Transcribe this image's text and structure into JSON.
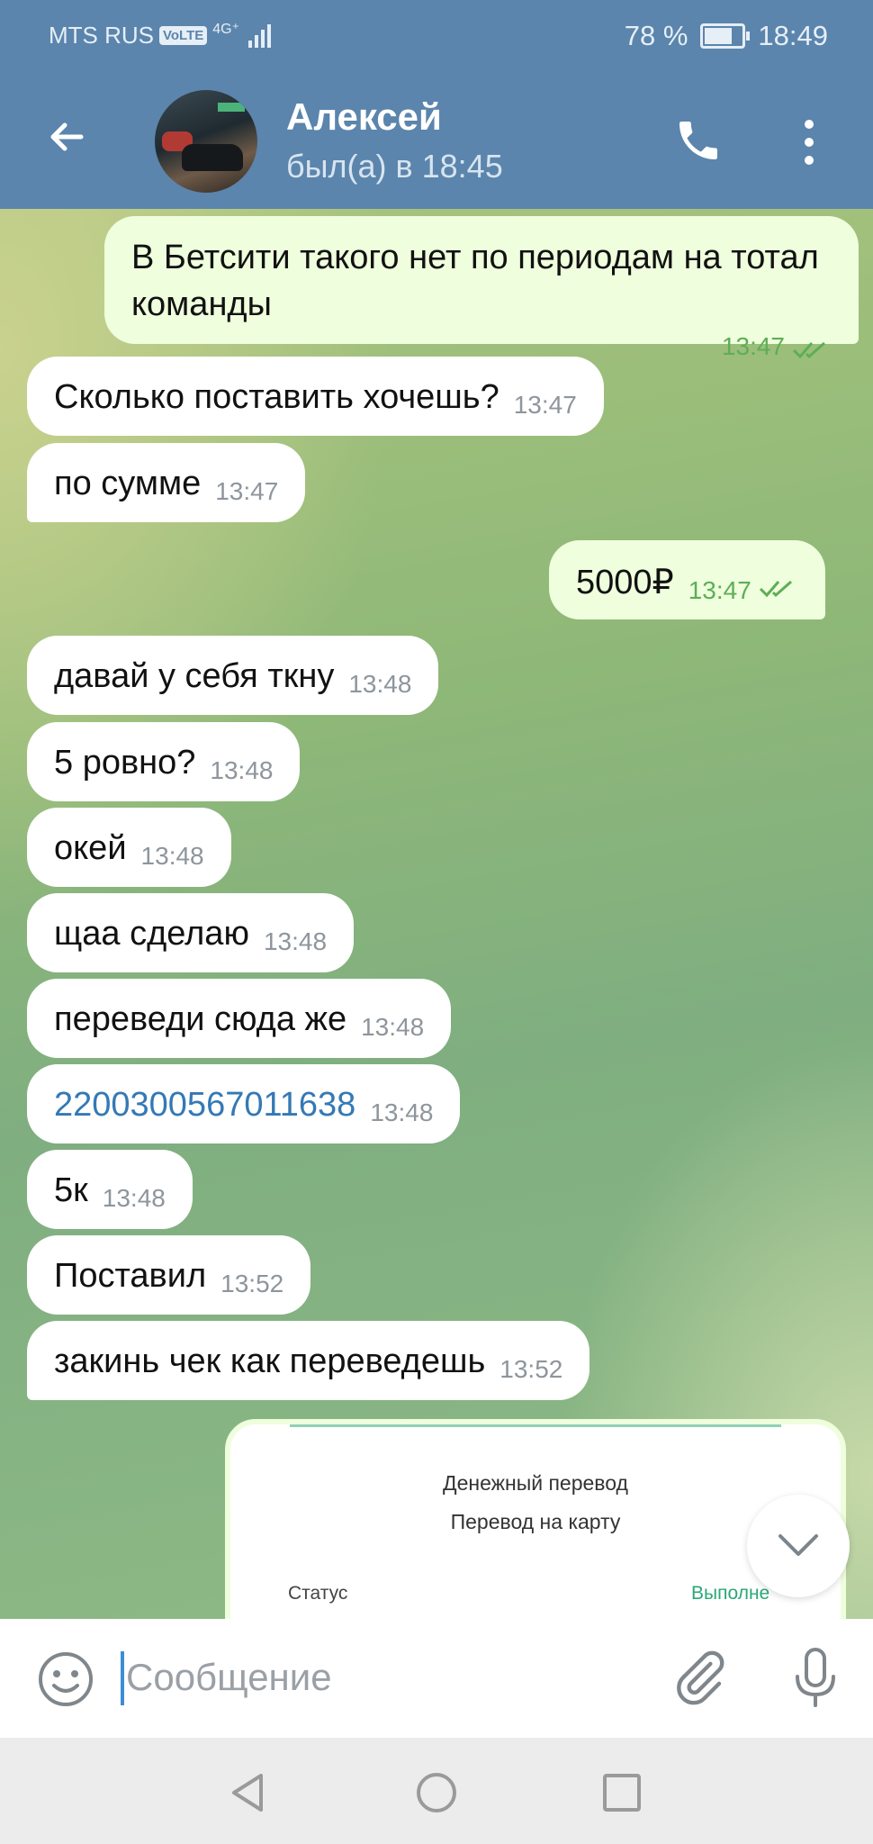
{
  "status_bar": {
    "carrier": "MTS RUS",
    "volte": "VoLTE",
    "network": "4G⁺",
    "battery": "78 %",
    "battery_level": 0.78,
    "time": "18:49"
  },
  "header": {
    "contact_name": "Алексей",
    "last_seen": "был(а) в 18:45"
  },
  "messages": [
    {
      "text": "В Бетсити такого нет по периодам на тотал команды",
      "time": "13:47",
      "outgoing": true
    },
    {
      "text": "Сколько поставить хочешь?",
      "time": "13:47",
      "outgoing": false
    },
    {
      "text": "по сумме",
      "time": "13:47",
      "outgoing": false
    },
    {
      "text": "5000₽",
      "time": "13:47",
      "outgoing": true
    },
    {
      "text": "давай у себя ткну",
      "time": "13:48",
      "outgoing": false
    },
    {
      "text": "5 ровно?",
      "time": "13:48",
      "outgoing": false
    },
    {
      "text": "окей",
      "time": "13:48",
      "outgoing": false
    },
    {
      "text": "щаа сделаю",
      "time": "13:48",
      "outgoing": false
    },
    {
      "text": "переведи сюда же",
      "time": "13:48",
      "outgoing": false
    },
    {
      "text": "2200300567011638",
      "time": "13:48",
      "outgoing": false
    },
    {
      "text": "5к",
      "time": "13:48",
      "outgoing": false
    },
    {
      "text": "Поставил",
      "time": "13:52",
      "outgoing": false
    },
    {
      "text": "закинь чек как переведешь",
      "time": "13:52",
      "outgoing": false
    }
  ],
  "receipt": {
    "title": "Денежный перевод",
    "subtitle": "Перевод на карту",
    "status_label": "Статус",
    "status_value": "Выполне"
  },
  "input": {
    "placeholder": "Сообщение"
  },
  "icons": {
    "back": "arrow-left-icon",
    "call": "phone-icon",
    "more": "more-vert-icon",
    "emoji": "emoji-icon",
    "attach": "paperclip-icon",
    "mic": "microphone-icon",
    "scroll": "chevron-down-icon"
  },
  "colors": {
    "header": "#5b85ac",
    "outgoing_bubble": "#effedd",
    "incoming_bubble": "#ffffff",
    "link": "#3479b5",
    "read_ticks": "#5eae56"
  }
}
